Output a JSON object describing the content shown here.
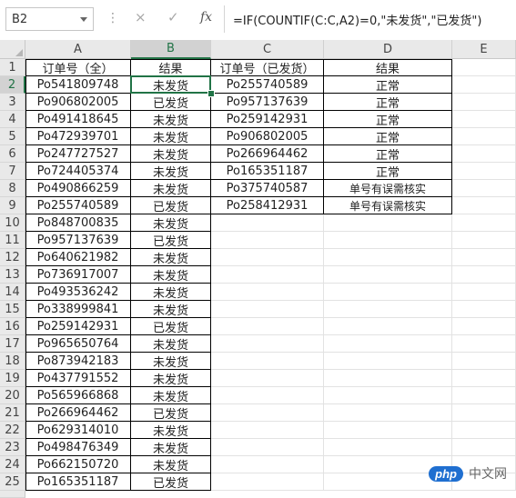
{
  "formula_bar": {
    "name_box": "B2",
    "formula": "=IF(COUNTIF(C:C,A2)=0,\"未发货\",\"已发货\")",
    "cancel_icon": "×",
    "enter_icon": "✓",
    "fx_label": "fx"
  },
  "columns": [
    "A",
    "B",
    "C",
    "D",
    "E"
  ],
  "rows": [
    [
      "订单号（全）",
      "结果",
      "订单号（已发货）",
      "结果"
    ],
    [
      "Po541809748",
      "未发货",
      "Po255740589",
      "正常"
    ],
    [
      "Po906802005",
      "已发货",
      "Po957137639",
      "正常"
    ],
    [
      "Po491418645",
      "未发货",
      "Po259142931",
      "正常"
    ],
    [
      "Po472939701",
      "未发货",
      "Po906802005",
      "正常"
    ],
    [
      "Po247727527",
      "未发货",
      "Po266964462",
      "正常"
    ],
    [
      "Po724405374",
      "未发货",
      "Po165351187",
      "正常"
    ],
    [
      "Po490866259",
      "未发货",
      "Po375740587",
      "单号有误需核实"
    ],
    [
      "Po255740589",
      "已发货",
      "Po258412931",
      "单号有误需核实"
    ],
    [
      "Po848700835",
      "未发货",
      "",
      ""
    ],
    [
      "Po957137639",
      "已发货",
      "",
      ""
    ],
    [
      "Po640621982",
      "未发货",
      "",
      ""
    ],
    [
      "Po736917007",
      "未发货",
      "",
      ""
    ],
    [
      "Po493536242",
      "未发货",
      "",
      ""
    ],
    [
      "Po338999841",
      "未发货",
      "",
      ""
    ],
    [
      "Po259142931",
      "已发货",
      "",
      ""
    ],
    [
      "Po965650764",
      "未发货",
      "",
      ""
    ],
    [
      "Po873942183",
      "未发货",
      "",
      ""
    ],
    [
      "Po437791552",
      "未发货",
      "",
      ""
    ],
    [
      "Po565966868",
      "未发货",
      "",
      ""
    ],
    [
      "Po266964462",
      "已发货",
      "",
      ""
    ],
    [
      "Po629314010",
      "未发货",
      "",
      ""
    ],
    [
      "Po498476349",
      "未发货",
      "",
      ""
    ],
    [
      "Po662150720",
      "未发货",
      "",
      ""
    ],
    [
      "Po165351187",
      "已发货",
      "",
      ""
    ]
  ],
  "active_cell": "B2",
  "watermark": {
    "badge": "php",
    "text": "中文网"
  },
  "colors": {
    "accent": "#217346",
    "header_bg": "#e9e9e9"
  }
}
